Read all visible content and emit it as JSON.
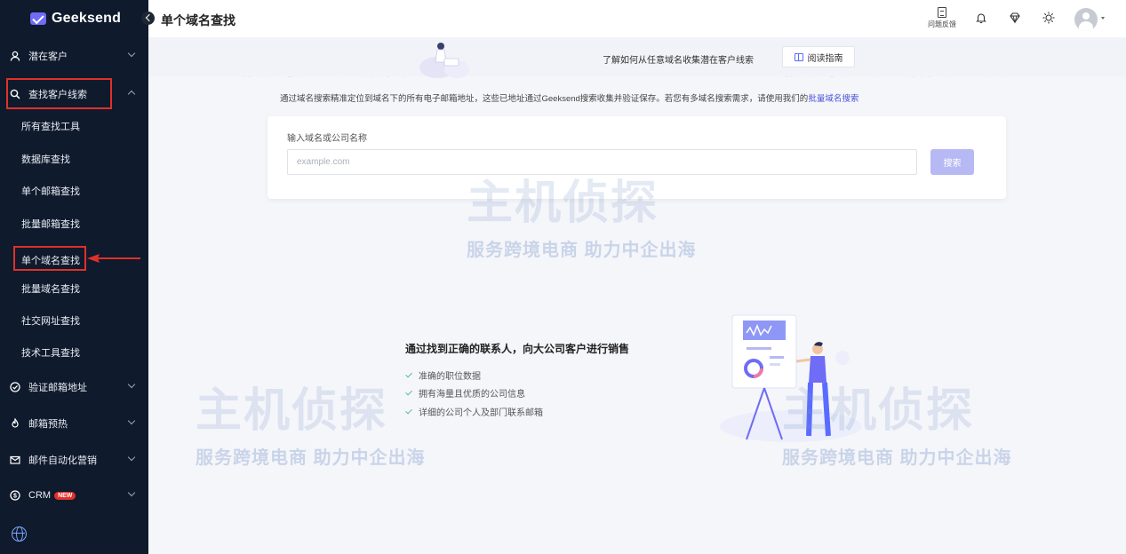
{
  "app": {
    "logo_text": "Geeksend"
  },
  "sidebar": {
    "items": [
      {
        "label": "潜在客户"
      },
      {
        "label": "查找客户线索"
      },
      {
        "label": "验证邮箱地址"
      },
      {
        "label": "邮箱预热"
      },
      {
        "label": "邮件自动化营销"
      },
      {
        "label": "CRM",
        "badge": "NEW"
      }
    ],
    "sub_items": [
      {
        "label": "所有查找工具"
      },
      {
        "label": "数据库查找"
      },
      {
        "label": "单个邮箱查找"
      },
      {
        "label": "批量邮箱查找"
      },
      {
        "label": "单个域名查找"
      },
      {
        "label": "批量域名查找"
      },
      {
        "label": "社交网址查找"
      },
      {
        "label": "技术工具查找"
      }
    ]
  },
  "header": {
    "title": "单个域名查找",
    "feedback_label": "问题反馈"
  },
  "banner": {
    "text": "了解如何从任意域名收集潜在客户线索",
    "guide_label": "阅读指南"
  },
  "description": {
    "text": "通过域名搜索精准定位到域名下的所有电子邮箱地址，这些已地址通过Geeksend搜索收集并验证保存。若您有多域名搜索需求，请使用我们的",
    "link": "批量域名搜索"
  },
  "search": {
    "label": "输入域名或公司名称",
    "placeholder": "example.com",
    "button_label": "搜索"
  },
  "features": {
    "title": "通过找到正确的联系人，向大公司客户进行销售",
    "items": [
      "准确的职位数据",
      "拥有海量且优质的公司信息",
      "详细的公司个人及部门联系邮箱"
    ]
  },
  "watermark": {
    "big": "主机侦探",
    "small": "服务跨境电商 助力中企出海"
  },
  "colors": {
    "sidebar_bg": "#0f1a2c",
    "accent": "#5a6cff",
    "annotation_red": "#e0302a"
  }
}
